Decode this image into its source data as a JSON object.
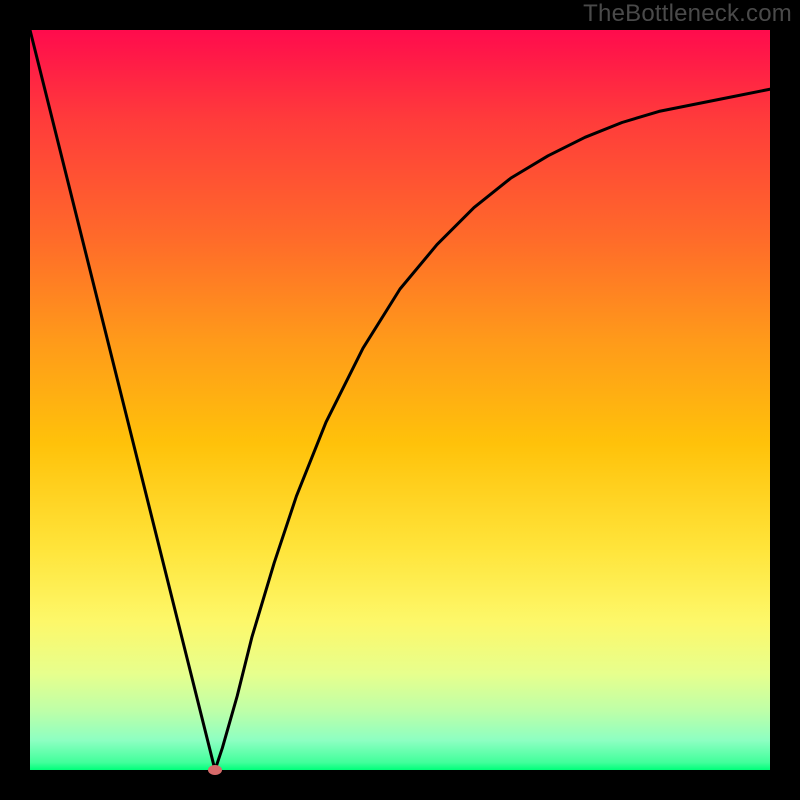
{
  "watermark": "TheBottleneck.com",
  "chart_data": {
    "type": "line",
    "title": "",
    "xlabel": "",
    "ylabel": "",
    "xlim": [
      0,
      100
    ],
    "ylim": [
      0,
      100
    ],
    "series": [
      {
        "name": "bottleneck-curve",
        "x": [
          0,
          5,
          10,
          15,
          20,
          24,
          25,
          26,
          28,
          30,
          33,
          36,
          40,
          45,
          50,
          55,
          60,
          65,
          70,
          75,
          80,
          85,
          90,
          95,
          100
        ],
        "y": [
          100,
          80,
          60,
          40,
          20,
          4,
          0,
          3,
          10,
          18,
          28,
          37,
          47,
          57,
          65,
          71,
          76,
          80,
          83,
          85.5,
          87.5,
          89,
          90,
          91,
          92
        ]
      }
    ],
    "marker": {
      "x": 25,
      "y": 0,
      "color": "#d76a6a"
    },
    "background_gradient": {
      "top": "#ff0b4d",
      "bottom": "#00ff7a"
    }
  }
}
